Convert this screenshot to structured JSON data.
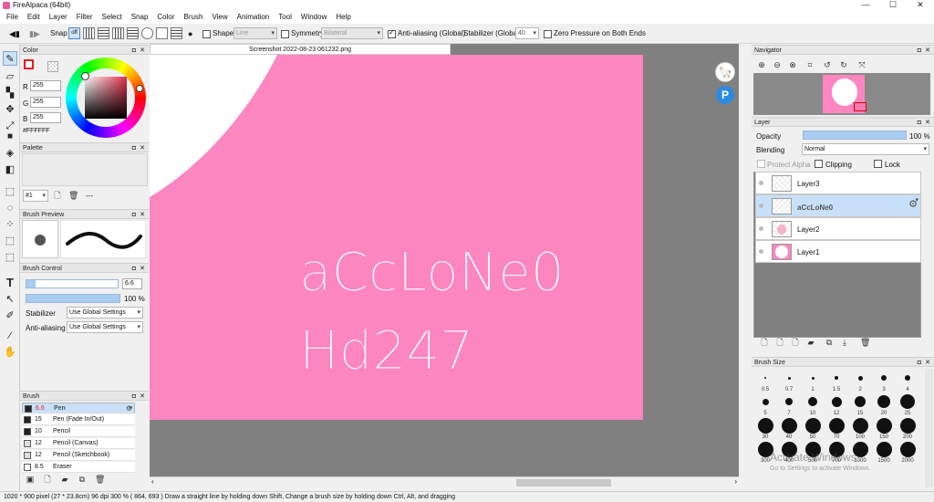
{
  "app": {
    "title": "FireAlpaca (64bit)",
    "window_buttons": [
      "—",
      "☐",
      "✕"
    ]
  },
  "menu": [
    "File",
    "Edit",
    "Layer",
    "Filter",
    "Select",
    "Snap",
    "Color",
    "Brush",
    "View",
    "Animation",
    "Tool",
    "Window",
    "Help"
  ],
  "toolbar": {
    "snap_label": "Snap",
    "snap_off": "off",
    "shape_label": "Shape",
    "shape_value": "Line",
    "symmetry_label": "Symmetry",
    "symmetry_value": "Bilateral",
    "antialias_label": "Anti-aliasing (Global)",
    "stabilizer_label": "Stabilizer (Global)",
    "stabilizer_value": "40",
    "zero_pressure_label": "Zero Pressure on Both Ends"
  },
  "color_panel": {
    "title": "Color",
    "r_label": "R",
    "r": "255",
    "g_label": "G",
    "g": "255",
    "b_label": "B",
    "b": "255",
    "hex": "#FFFFFF"
  },
  "palette_panel": {
    "title": "Palette",
    "set": "#1",
    "more": "---"
  },
  "brush_preview": {
    "title": "Brush Preview"
  },
  "brush_control": {
    "title": "Brush Control",
    "size": "6.6",
    "opacity": "100 %",
    "opacity_fraction": 1.0,
    "size_fraction": 0.1,
    "stabilizer_label": "Stabilizer",
    "stabilizer_value": "Use Global Settings",
    "antialias_label": "Anti-aliasing",
    "antialias_value": "Use Global Settings"
  },
  "brush_list": {
    "title": "Brush",
    "items": [
      {
        "size": "6.6",
        "name": "Pen"
      },
      {
        "size": "15",
        "name": "Pen (Fade In/Out)"
      },
      {
        "size": "10",
        "name": "Pencil"
      },
      {
        "size": "12",
        "name": "Pencil (Canvas)"
      },
      {
        "size": "12",
        "name": "Pencil (Sketchbook)"
      },
      {
        "size": "8.5",
        "name": "Eraser"
      }
    ]
  },
  "canvas": {
    "tab": "Screenshot 2022-08-23 061232.png",
    "line1": "aCcLoNe0",
    "line2": "Hd247",
    "bg_color": "#fb86c0"
  },
  "navigator": {
    "title": "Navigator"
  },
  "layer_panel": {
    "title": "Layer",
    "opacity_label": "Opacity",
    "opacity": "100 %",
    "opacity_fraction": 1.0,
    "blending_label": "Blending",
    "blending_value": "Normal",
    "protect_alpha": "Protect Alpha",
    "clipping": "Clipping",
    "lock": "Lock",
    "layers": [
      "Layer3",
      "aCcLoNe0",
      "Layer2",
      "Layer1"
    ]
  },
  "brush_size": {
    "title": "Brush Size",
    "sizes": [
      "0.5",
      "0.7",
      "1",
      "1.5",
      "2",
      "3",
      "4",
      "5",
      "7",
      "10",
      "12",
      "15",
      "20",
      "25",
      "30",
      "40",
      "50",
      "70",
      "100",
      "150",
      "200",
      "300",
      "400",
      "500",
      "700",
      "1000",
      "1500",
      "2000"
    ]
  },
  "watermark": {
    "line1": "Activate Windows",
    "line2": "Go to Settings to activate Windows."
  },
  "status": "1020 * 900 pixel   (27 * 23.8cm)   96 dpi   300 %   ( 864, 693 )   Draw a straight line by holding down Shift, Change a brush size by holding down Ctrl, Alt, and dragging"
}
